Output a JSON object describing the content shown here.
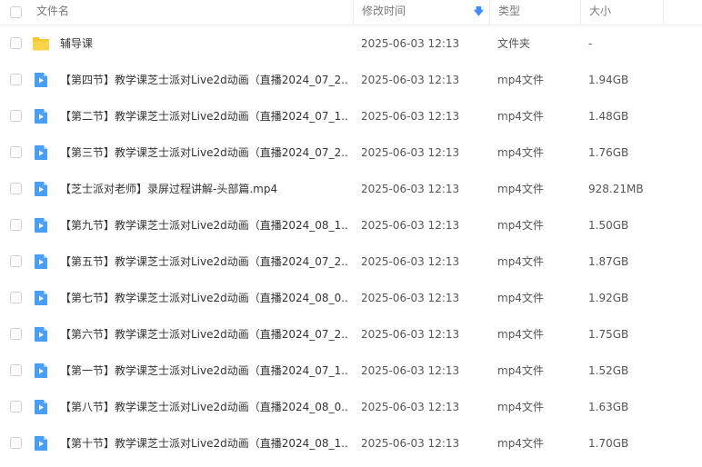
{
  "header": {
    "name": "文件名",
    "mtime": "修改时间",
    "type": "类型",
    "size": "大小"
  },
  "files": [
    {
      "icon": "folder-icon",
      "name": "辅导课",
      "mtime": "2025-06-03 12:13",
      "type": "文件夹",
      "size": "-"
    },
    {
      "icon": "video-file-icon",
      "name": "【第四节】教学课芝士派对Live2d动画（直播2024_07_2...",
      "mtime": "2025-06-03 12:13",
      "type": "mp4文件",
      "size": "1.94GB"
    },
    {
      "icon": "video-file-icon",
      "name": "【第二节】教学课芝士派对Live2d动画（直播2024_07_1...",
      "mtime": "2025-06-03 12:13",
      "type": "mp4文件",
      "size": "1.48GB"
    },
    {
      "icon": "video-file-icon",
      "name": "【第三节】教学课芝士派对Live2d动画（直播2024_07_2...",
      "mtime": "2025-06-03 12:13",
      "type": "mp4文件",
      "size": "1.76GB"
    },
    {
      "icon": "video-file-icon",
      "name": "【芝士派对老师】录屏过程讲解-头部篇.mp4",
      "mtime": "2025-06-03 12:13",
      "type": "mp4文件",
      "size": "928.21MB"
    },
    {
      "icon": "video-file-icon",
      "name": "【第九节】教学课芝士派对Live2d动画（直播2024_08_1...",
      "mtime": "2025-06-03 12:13",
      "type": "mp4文件",
      "size": "1.50GB"
    },
    {
      "icon": "video-file-icon",
      "name": "【第五节】教学课芝士派对Live2d动画（直播2024_07_2...",
      "mtime": "2025-06-03 12:13",
      "type": "mp4文件",
      "size": "1.87GB"
    },
    {
      "icon": "video-file-icon",
      "name": "【第七节】教学课芝士派对Live2d动画（直播2024_08_0...",
      "mtime": "2025-06-03 12:13",
      "type": "mp4文件",
      "size": "1.92GB"
    },
    {
      "icon": "video-file-icon",
      "name": "【第六节】教学课芝士派对Live2d动画（直播2024_07_2...",
      "mtime": "2025-06-03 12:13",
      "type": "mp4文件",
      "size": "1.75GB"
    },
    {
      "icon": "video-file-icon",
      "name": "【第一节】教学课芝士派对Live2d动画（直播2024_07_1...",
      "mtime": "2025-06-03 12:13",
      "type": "mp4文件",
      "size": "1.52GB"
    },
    {
      "icon": "video-file-icon",
      "name": "【第八节】教学课芝士派对Live2d动画（直播2024_08_0...",
      "mtime": "2025-06-03 12:13",
      "type": "mp4文件",
      "size": "1.63GB"
    },
    {
      "icon": "video-file-icon",
      "name": "【第十节】教学课芝士派对Live2d动画（直播2024_08_1...",
      "mtime": "2025-06-03 12:13",
      "type": "mp4文件",
      "size": "1.70GB"
    }
  ],
  "colors": {
    "folder": "#f9c533",
    "video": "#4a9ff5",
    "sort_arrow": "#3b8cff"
  }
}
